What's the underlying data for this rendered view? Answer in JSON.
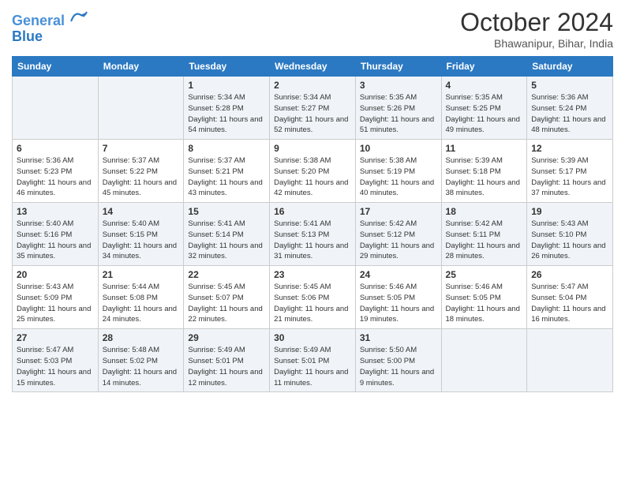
{
  "header": {
    "logo_line1": "General",
    "logo_line2": "Blue",
    "month": "October 2024",
    "location": "Bhawanipur, Bihar, India"
  },
  "columns": [
    "Sunday",
    "Monday",
    "Tuesday",
    "Wednesday",
    "Thursday",
    "Friday",
    "Saturday"
  ],
  "weeks": [
    [
      {
        "day": "",
        "sunrise": "",
        "sunset": "",
        "daylight": ""
      },
      {
        "day": "",
        "sunrise": "",
        "sunset": "",
        "daylight": ""
      },
      {
        "day": "1",
        "sunrise": "Sunrise: 5:34 AM",
        "sunset": "Sunset: 5:28 PM",
        "daylight": "Daylight: 11 hours and 54 minutes."
      },
      {
        "day": "2",
        "sunrise": "Sunrise: 5:34 AM",
        "sunset": "Sunset: 5:27 PM",
        "daylight": "Daylight: 11 hours and 52 minutes."
      },
      {
        "day": "3",
        "sunrise": "Sunrise: 5:35 AM",
        "sunset": "Sunset: 5:26 PM",
        "daylight": "Daylight: 11 hours and 51 minutes."
      },
      {
        "day": "4",
        "sunrise": "Sunrise: 5:35 AM",
        "sunset": "Sunset: 5:25 PM",
        "daylight": "Daylight: 11 hours and 49 minutes."
      },
      {
        "day": "5",
        "sunrise": "Sunrise: 5:36 AM",
        "sunset": "Sunset: 5:24 PM",
        "daylight": "Daylight: 11 hours and 48 minutes."
      }
    ],
    [
      {
        "day": "6",
        "sunrise": "Sunrise: 5:36 AM",
        "sunset": "Sunset: 5:23 PM",
        "daylight": "Daylight: 11 hours and 46 minutes."
      },
      {
        "day": "7",
        "sunrise": "Sunrise: 5:37 AM",
        "sunset": "Sunset: 5:22 PM",
        "daylight": "Daylight: 11 hours and 45 minutes."
      },
      {
        "day": "8",
        "sunrise": "Sunrise: 5:37 AM",
        "sunset": "Sunset: 5:21 PM",
        "daylight": "Daylight: 11 hours and 43 minutes."
      },
      {
        "day": "9",
        "sunrise": "Sunrise: 5:38 AM",
        "sunset": "Sunset: 5:20 PM",
        "daylight": "Daylight: 11 hours and 42 minutes."
      },
      {
        "day": "10",
        "sunrise": "Sunrise: 5:38 AM",
        "sunset": "Sunset: 5:19 PM",
        "daylight": "Daylight: 11 hours and 40 minutes."
      },
      {
        "day": "11",
        "sunrise": "Sunrise: 5:39 AM",
        "sunset": "Sunset: 5:18 PM",
        "daylight": "Daylight: 11 hours and 38 minutes."
      },
      {
        "day": "12",
        "sunrise": "Sunrise: 5:39 AM",
        "sunset": "Sunset: 5:17 PM",
        "daylight": "Daylight: 11 hours and 37 minutes."
      }
    ],
    [
      {
        "day": "13",
        "sunrise": "Sunrise: 5:40 AM",
        "sunset": "Sunset: 5:16 PM",
        "daylight": "Daylight: 11 hours and 35 minutes."
      },
      {
        "day": "14",
        "sunrise": "Sunrise: 5:40 AM",
        "sunset": "Sunset: 5:15 PM",
        "daylight": "Daylight: 11 hours and 34 minutes."
      },
      {
        "day": "15",
        "sunrise": "Sunrise: 5:41 AM",
        "sunset": "Sunset: 5:14 PM",
        "daylight": "Daylight: 11 hours and 32 minutes."
      },
      {
        "day": "16",
        "sunrise": "Sunrise: 5:41 AM",
        "sunset": "Sunset: 5:13 PM",
        "daylight": "Daylight: 11 hours and 31 minutes."
      },
      {
        "day": "17",
        "sunrise": "Sunrise: 5:42 AM",
        "sunset": "Sunset: 5:12 PM",
        "daylight": "Daylight: 11 hours and 29 minutes."
      },
      {
        "day": "18",
        "sunrise": "Sunrise: 5:42 AM",
        "sunset": "Sunset: 5:11 PM",
        "daylight": "Daylight: 11 hours and 28 minutes."
      },
      {
        "day": "19",
        "sunrise": "Sunrise: 5:43 AM",
        "sunset": "Sunset: 5:10 PM",
        "daylight": "Daylight: 11 hours and 26 minutes."
      }
    ],
    [
      {
        "day": "20",
        "sunrise": "Sunrise: 5:43 AM",
        "sunset": "Sunset: 5:09 PM",
        "daylight": "Daylight: 11 hours and 25 minutes."
      },
      {
        "day": "21",
        "sunrise": "Sunrise: 5:44 AM",
        "sunset": "Sunset: 5:08 PM",
        "daylight": "Daylight: 11 hours and 24 minutes."
      },
      {
        "day": "22",
        "sunrise": "Sunrise: 5:45 AM",
        "sunset": "Sunset: 5:07 PM",
        "daylight": "Daylight: 11 hours and 22 minutes."
      },
      {
        "day": "23",
        "sunrise": "Sunrise: 5:45 AM",
        "sunset": "Sunset: 5:06 PM",
        "daylight": "Daylight: 11 hours and 21 minutes."
      },
      {
        "day": "24",
        "sunrise": "Sunrise: 5:46 AM",
        "sunset": "Sunset: 5:05 PM",
        "daylight": "Daylight: 11 hours and 19 minutes."
      },
      {
        "day": "25",
        "sunrise": "Sunrise: 5:46 AM",
        "sunset": "Sunset: 5:05 PM",
        "daylight": "Daylight: 11 hours and 18 minutes."
      },
      {
        "day": "26",
        "sunrise": "Sunrise: 5:47 AM",
        "sunset": "Sunset: 5:04 PM",
        "daylight": "Daylight: 11 hours and 16 minutes."
      }
    ],
    [
      {
        "day": "27",
        "sunrise": "Sunrise: 5:47 AM",
        "sunset": "Sunset: 5:03 PM",
        "daylight": "Daylight: 11 hours and 15 minutes."
      },
      {
        "day": "28",
        "sunrise": "Sunrise: 5:48 AM",
        "sunset": "Sunset: 5:02 PM",
        "daylight": "Daylight: 11 hours and 14 minutes."
      },
      {
        "day": "29",
        "sunrise": "Sunrise: 5:49 AM",
        "sunset": "Sunset: 5:01 PM",
        "daylight": "Daylight: 11 hours and 12 minutes."
      },
      {
        "day": "30",
        "sunrise": "Sunrise: 5:49 AM",
        "sunset": "Sunset: 5:01 PM",
        "daylight": "Daylight: 11 hours and 11 minutes."
      },
      {
        "day": "31",
        "sunrise": "Sunrise: 5:50 AM",
        "sunset": "Sunset: 5:00 PM",
        "daylight": "Daylight: 11 hours and 9 minutes."
      },
      {
        "day": "",
        "sunrise": "",
        "sunset": "",
        "daylight": ""
      },
      {
        "day": "",
        "sunrise": "",
        "sunset": "",
        "daylight": ""
      }
    ]
  ]
}
